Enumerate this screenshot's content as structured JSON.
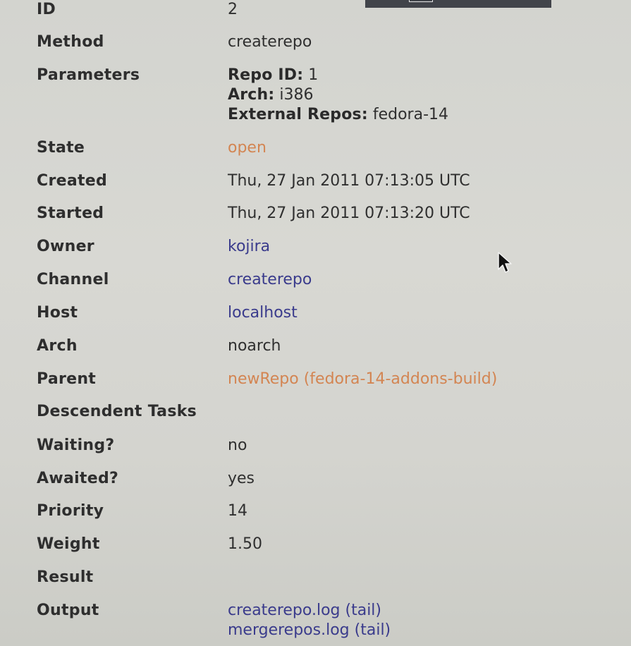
{
  "topbar": {},
  "fields": {
    "id": {
      "label": "ID",
      "value": "2"
    },
    "method": {
      "label": "Method",
      "value": "createrepo"
    },
    "parameters": {
      "label": "Parameters",
      "items": [
        {
          "key": "Repo ID:",
          "value": "1"
        },
        {
          "key": "Arch:",
          "value": "i386"
        },
        {
          "key": "External Repos:",
          "value": "fedora-14"
        }
      ]
    },
    "state": {
      "label": "State",
      "value": "open",
      "color": "#d38552"
    },
    "created": {
      "label": "Created",
      "value": "Thu, 27 Jan 2011 07:13:05 UTC"
    },
    "started": {
      "label": "Started",
      "value": "Thu, 27 Jan 2011 07:13:20 UTC"
    },
    "owner": {
      "label": "Owner",
      "value": "kojira"
    },
    "channel": {
      "label": "Channel",
      "value": "createrepo"
    },
    "host": {
      "label": "Host",
      "value": "localhost"
    },
    "arch": {
      "label": "Arch",
      "value": "noarch"
    },
    "parent": {
      "label": "Parent",
      "value": "newRepo (fedora-14-addons-build)",
      "color": "#d38552"
    },
    "descendent_tasks": {
      "label": "Descendent Tasks",
      "value": ""
    },
    "waiting": {
      "label": "Waiting?",
      "value": "no"
    },
    "awaited": {
      "label": "Awaited?",
      "value": "yes"
    },
    "priority": {
      "label": "Priority",
      "value": "14"
    },
    "weight": {
      "label": "Weight",
      "value": "1.50"
    },
    "result": {
      "label": "Result",
      "value": ""
    },
    "output": {
      "label": "Output",
      "files": [
        {
          "name": "createrepo.log",
          "action": "(tail)"
        },
        {
          "name": "mergerepos.log",
          "action": "(tail)"
        }
      ]
    }
  },
  "colors": {
    "link": "#3a3b8c",
    "status_open": "#d38552",
    "label": "#2e2e2e"
  },
  "icons": {
    "pointer": "mouse-pointer-icon"
  }
}
